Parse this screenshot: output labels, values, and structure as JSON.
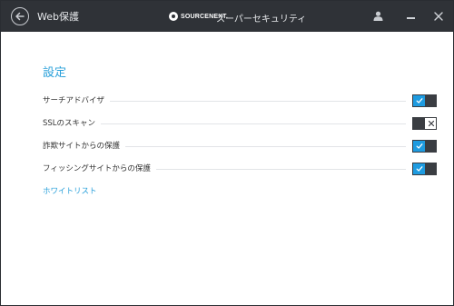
{
  "titlebar": {
    "back_icon": "back-arrow-icon",
    "section_title": "Web保護",
    "brand": "SOURCENEXT.",
    "app_title": "スーパーセキュリティ",
    "user_icon": "user-icon",
    "minimize_icon": "minimize-icon",
    "close_icon": "close-icon"
  },
  "page": {
    "title": "設定"
  },
  "settings": [
    {
      "label": "サーチアドバイザ",
      "enabled": true
    },
    {
      "label": "SSLのスキャン",
      "enabled": false
    },
    {
      "label": "詐欺サイトからの保護",
      "enabled": true
    },
    {
      "label": "フィッシングサイトからの保護",
      "enabled": true
    }
  ],
  "links": {
    "whitelist": "ホワイトリスト"
  },
  "colors": {
    "titlebar_bg": "#2f3237",
    "accent": "#2aa0da",
    "toggle_on": "#1e9be0",
    "toggle_dark": "#3a3d42"
  }
}
